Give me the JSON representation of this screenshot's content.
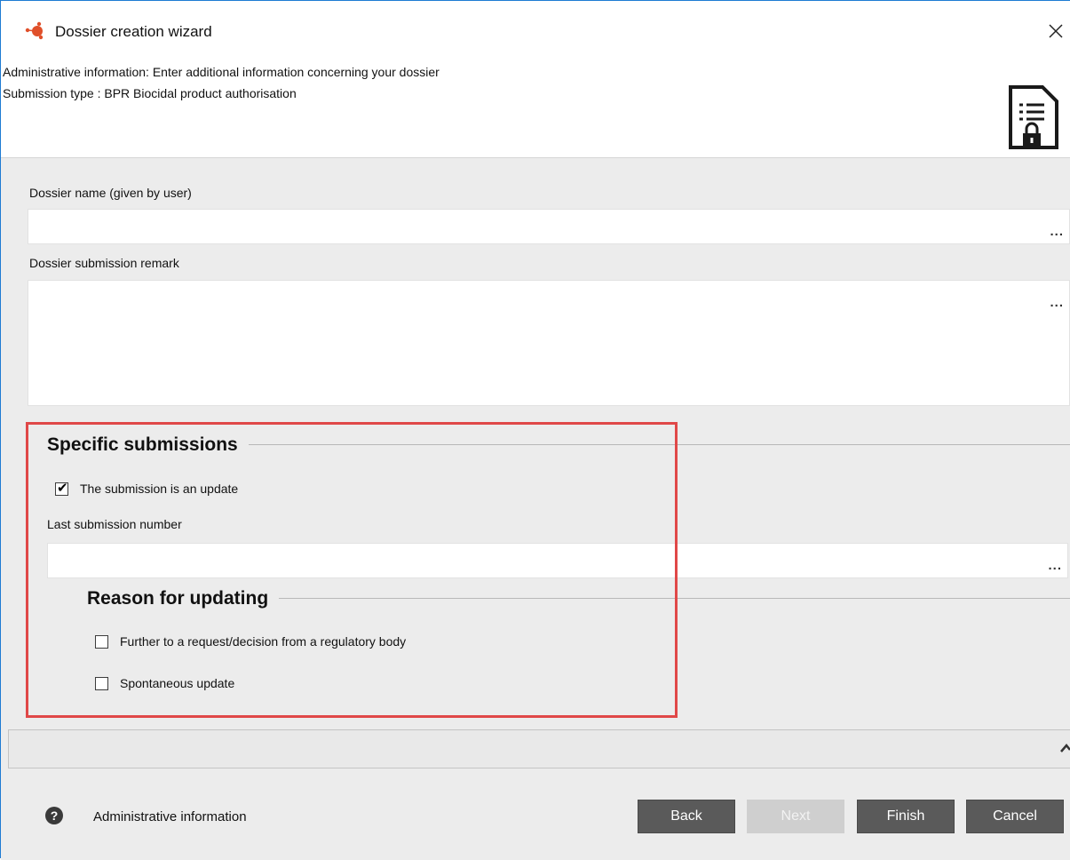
{
  "window": {
    "title": "Dossier creation wizard",
    "close_icon": "close-icon"
  },
  "header": {
    "line1": "Administrative information: Enter additional information concerning your dossier",
    "line2": "Submission type : BPR Biocidal product authorisation",
    "icon": "document-lock-icon"
  },
  "form": {
    "dossier_name": {
      "label": "Dossier name (given by user)",
      "value": "",
      "button": "..."
    },
    "submission_remark": {
      "label": "Dossier submission remark",
      "value": "",
      "button": "..."
    }
  },
  "specific_submissions": {
    "title": "Specific submissions",
    "is_update": {
      "label": "The submission is an update",
      "checked": true
    },
    "last_submission_number": {
      "label": "Last submission number",
      "value": "",
      "button": "..."
    },
    "reason": {
      "title": "Reason for updating",
      "options": [
        {
          "label": "Further to a request/decision from a regulatory body",
          "checked": false
        },
        {
          "label": "Spontaneous update",
          "checked": false
        }
      ]
    }
  },
  "footer": {
    "help_icon": "help-icon",
    "step_label": "Administrative information",
    "buttons": {
      "back": "Back",
      "next": "Next",
      "finish": "Finish",
      "cancel": "Cancel"
    }
  },
  "colors": {
    "window_border": "#1e7bd3",
    "highlight": "#e04848",
    "button_bg": "#5a5a5a",
    "button_disabled": "#cfcfcf",
    "body_bg": "#ececec"
  }
}
